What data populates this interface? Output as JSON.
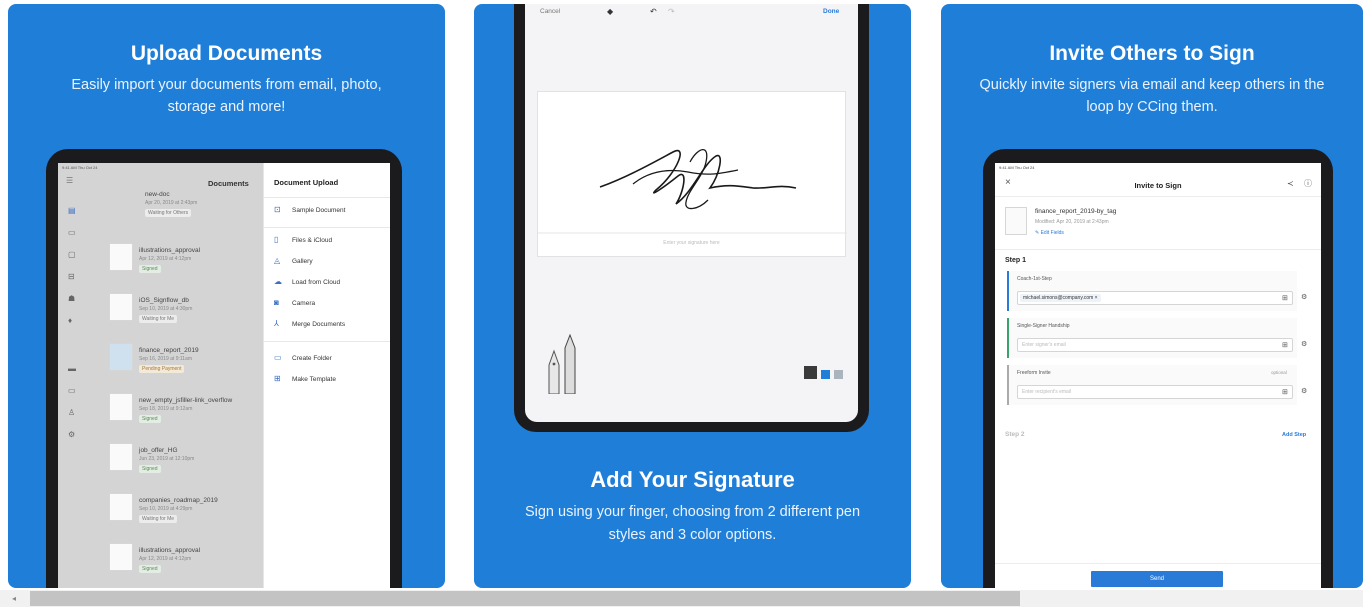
{
  "panels": [
    {
      "title": "Upload Documents",
      "subtitle_lines": [
        "Easily import your documents from email, photo,",
        "storage and more!"
      ]
    },
    {
      "title": "Add Your Signature",
      "subtitle_lines": [
        "Sign using your finger, choosing from 2 different pen",
        "styles and 3 color options."
      ]
    },
    {
      "title": "Invite Others to Sign",
      "subtitle_lines": [
        "Quickly invite signers via email and keep others in the",
        "loop by CCing them."
      ]
    }
  ],
  "upload": {
    "status_bar": "9:41 AM Thu Oct 24",
    "list_title": "Documents",
    "docs": [
      {
        "name": "new-doc",
        "date": "Apr 20, 2019 at 2:43pm",
        "status": "Waiting for Others"
      },
      {
        "name": "illustrations_approval",
        "date": "Apr 12, 2019 at 4:12pm",
        "status": "Signed"
      },
      {
        "name": "iOS_Signflow_db",
        "date": "Sep 10, 2019 at 4:30pm",
        "status": "Waiting for Me"
      },
      {
        "name": "finance_report_2019",
        "date": "Sep 16, 2019 at 9:11am",
        "status": "Pending Payment"
      },
      {
        "name": "new_empty_jsfiller-link_overflow",
        "date": "Sep 18, 2019 at 9:12am",
        "status": "Signed"
      },
      {
        "name": "job_offer_HG",
        "date": "Jun 23, 2019 at 12:10pm",
        "status": "Signed"
      },
      {
        "name": "companies_roadmap_2019",
        "date": "Sep 10, 2019 at 4:29pm",
        "status": "Waiting for Me"
      },
      {
        "name": "illustrations_approval",
        "date": "Apr 12, 2019 at 4:12pm",
        "status": "Signed"
      }
    ],
    "menu_title": "Document Upload",
    "menu": [
      "Sample Document",
      "Files & iCloud",
      "Gallery",
      "Load from Cloud",
      "Camera",
      "Merge Documents",
      "Create Folder",
      "Make Template"
    ]
  },
  "sign": {
    "cancel": "Cancel",
    "done": "Done",
    "placeholder": "Enter your signature here"
  },
  "invite": {
    "status_bar": "9:41 AM Thu Oct 24",
    "title": "Invite to Sign",
    "doc_name": "finance_report_2019-by_tag",
    "doc_meta": "Modified: Apr 20, 2019 at 2:43pm",
    "edit_fields": "Edit Fields",
    "step1": "Step 1",
    "coach_label": "Coach-1st-Step",
    "coach_chip": "michael.simons@company.com ×",
    "single_label": "Single-Signer Handship",
    "single_placeholder": "Enter signer's email",
    "freeform_label": "Freeform Invite",
    "optional": "optional",
    "freeform_placeholder": "Enter recipient's email",
    "step2": "Step 2",
    "add_step": "Add Step",
    "send": "Send"
  },
  "colors": {
    "panel": "#1f7ed8",
    "accent": "#2a7ad8"
  }
}
